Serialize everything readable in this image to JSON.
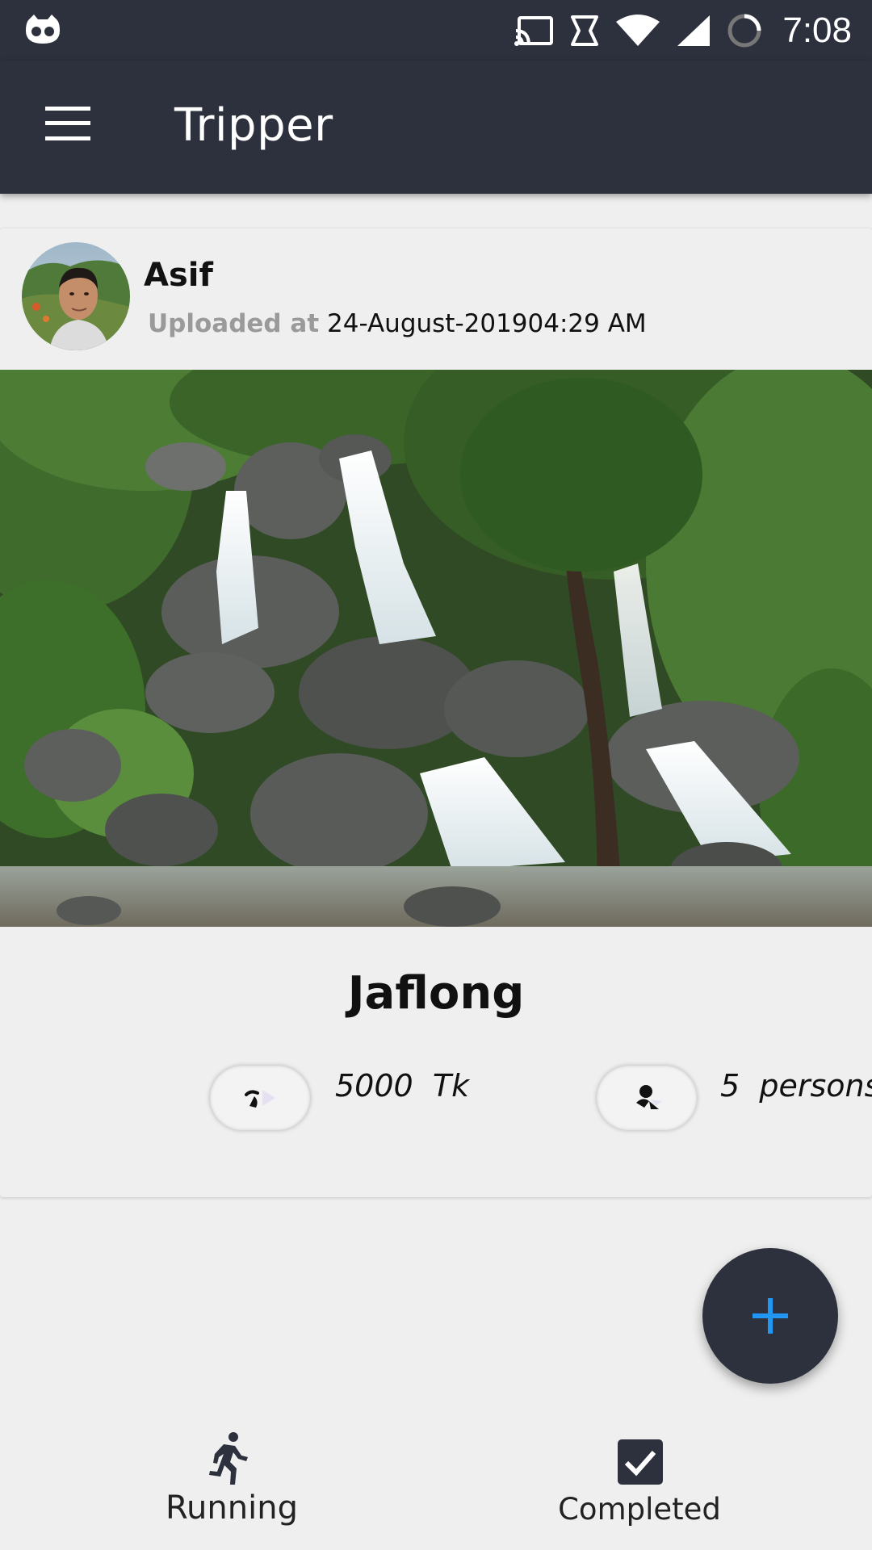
{
  "status_bar": {
    "time": "7:08",
    "icons": [
      "cyanogen-icon",
      "cast-icon",
      "nfc-icon",
      "wifi-icon",
      "signal-icon",
      "sync-icon"
    ]
  },
  "app_bar": {
    "title": "Tripper",
    "menu_icon": "hamburger-menu-icon"
  },
  "post": {
    "user_name": "Asif",
    "uploaded_label": "Uploaded at",
    "uploaded_value": "24-August-201904:29 AM",
    "place": "Jaflong",
    "cost_value": "5000  Tk",
    "persons_value": "5  persons",
    "cost_icon": "cost-icon",
    "persons_icon": "persons-icon"
  },
  "fab": {
    "icon": "plus-icon",
    "color": "#2196f3"
  },
  "bottom_nav": {
    "items": [
      {
        "label": "Running",
        "icon": "running-icon"
      },
      {
        "label": "Completed",
        "icon": "checkbox-icon"
      }
    ]
  },
  "colors": {
    "app_bar": "#2d313d",
    "background": "#efefef",
    "accent": "#2196f3"
  }
}
